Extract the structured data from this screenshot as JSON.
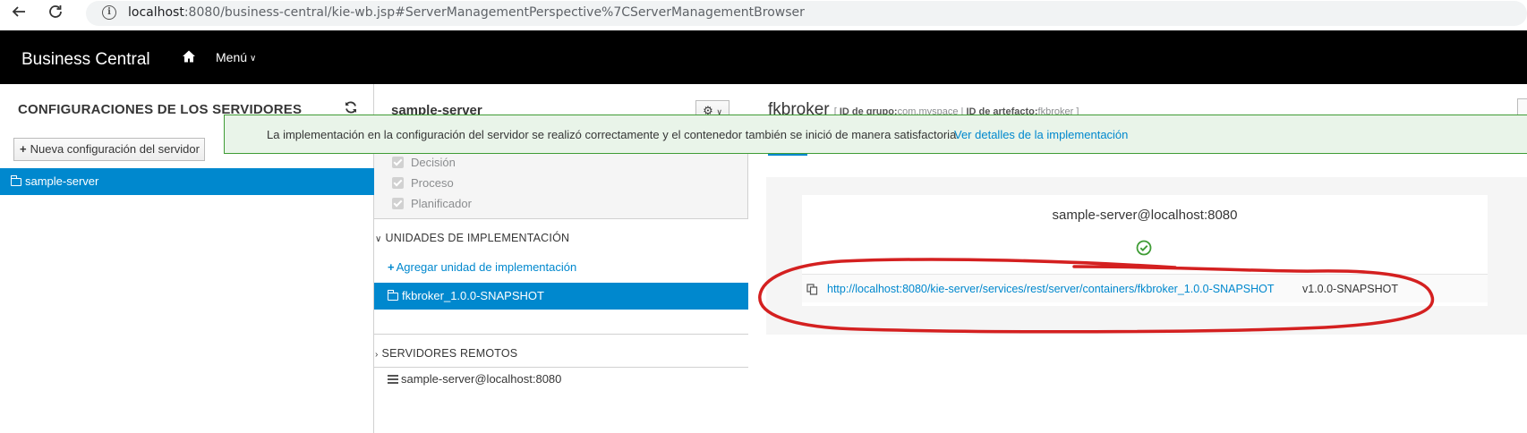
{
  "browser": {
    "back_icon": "arrow-left-icon",
    "reload_icon": "reload-icon",
    "url_host": "localhost",
    "url_rest": ":8080/business-central/kie-wb.jsp#ServerManagementPerspective%7CServerManagementBrowser"
  },
  "header": {
    "brand": "Business Central",
    "home_icon": "home-icon",
    "menu_label": "Menú"
  },
  "servers_panel": {
    "title": "CONFIGURACIONES DE LOS SERVIDORES",
    "new_config_label": "Nueva configuración del servidor",
    "items": [
      {
        "label": "sample-server",
        "selected": true
      }
    ]
  },
  "server_panel": {
    "title": "sample-server",
    "capabilities": [
      {
        "label": "Decisión",
        "checked": true
      },
      {
        "label": "Proceso",
        "checked": true
      },
      {
        "label": "Planificador",
        "checked": true
      }
    ],
    "deployment_units_header": "UNIDADES DE IMPLEMENTACIÓN",
    "add_unit_label": "Agregar unidad de implementación",
    "deployment_units": [
      {
        "label": "fkbroker_1.0.0-SNAPSHOT",
        "selected": true
      }
    ],
    "remote_servers_header": "SERVIDORES REMOTOS",
    "remote_servers": [
      {
        "label": "sample-server@localhost:8080"
      }
    ]
  },
  "container_panel": {
    "title": "fkbroker",
    "meta_open": "[",
    "group_id_label": "ID de grupo:",
    "group_id": "com.myspace",
    "meta_sep": "|",
    "artifact_id_label": "ID de artefacto:",
    "artifact_id": "fkbroker",
    "meta_close": "]",
    "status": {
      "server_name": "sample-server@localhost:8080",
      "status_icon": "check-circle-icon",
      "status_color": "#3f9c35",
      "url": "http://localhost:8080/kie-server/services/rest/server/containers/fkbroker_1.0.0-SNAPSHOT",
      "version": "v1.0.0-SNAPSHOT"
    }
  },
  "notification": {
    "message": "La implementación en la configuración del servidor se realizó correctamente y el contenedor también se inició de manera satisfactoria.",
    "link": "Ver detalles de la implementación",
    "color": "#3f9c35"
  },
  "colors": {
    "accent": "#0088ce",
    "header_bg": "#000000",
    "annotation": "#d42020"
  }
}
